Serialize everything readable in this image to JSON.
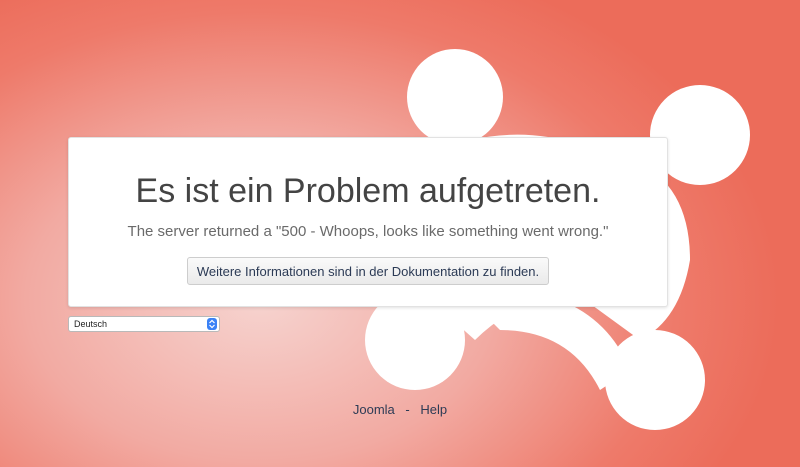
{
  "error": {
    "title": "Es ist ein Problem aufgetreten.",
    "message": "The server returned a \"500 - Whoops, looks like something went wrong.\"",
    "doc_button_label": "Weitere Informationen sind in der Dokumentation zu finden."
  },
  "language_select": {
    "selected": "Deutsch"
  },
  "footer": {
    "links": [
      "Joomla",
      "Help"
    ],
    "separator": "-"
  },
  "colors": {
    "background_outer": "#ec6c5a",
    "background_center": "#f6d3cf",
    "logo": "#ffffff",
    "link": "#2d3b55"
  },
  "icons": {
    "background_logo": "joomla-logo-icon",
    "select_arrow": "chevron-updown-icon"
  }
}
